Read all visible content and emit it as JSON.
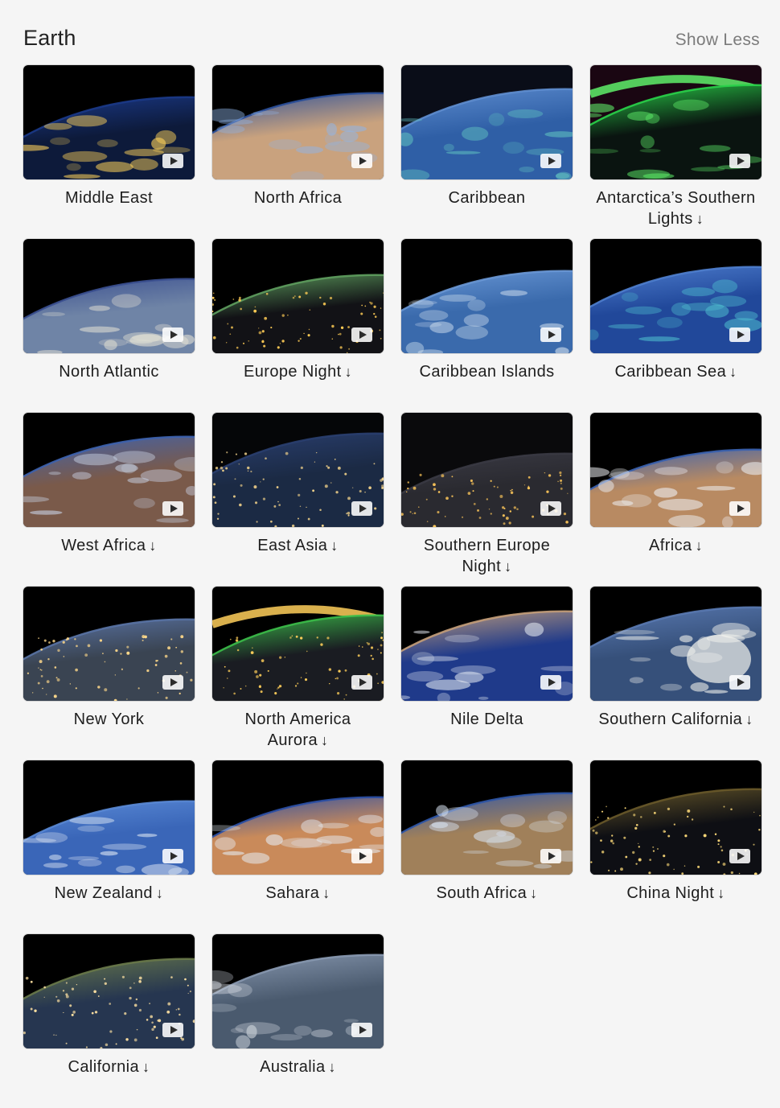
{
  "section": {
    "title": "Earth",
    "toggle_label": "Show Less"
  },
  "download_glyph": "↓",
  "tiles": [
    {
      "name": "Middle East",
      "downloadable": false,
      "scene": "dayrim",
      "colors": {
        "sky": "#000000",
        "ground": "#0d1a3a",
        "rim": "#1b3a8a",
        "glow": "#ffd35a"
      }
    },
    {
      "name": "North Africa",
      "downloadable": false,
      "scene": "desert",
      "colors": {
        "sky": "#000000",
        "ground": "#c9a27e",
        "rim": "#2a4f9a",
        "glow": "#8fb5e8"
      }
    },
    {
      "name": "Caribbean",
      "downloadable": false,
      "scene": "ocean",
      "colors": {
        "sky": "#0a0d18",
        "ground": "#2f5fa6",
        "rim": "#5f8ed0",
        "glow": "#5fc0c0"
      }
    },
    {
      "name": "Antarctica’s Southern Lights",
      "downloadable": true,
      "scene": "aurora",
      "colors": {
        "sky": "#1a0612",
        "ground": "#0a1410",
        "rim": "#2ad44a",
        "glow": "#5ff06a"
      }
    },
    {
      "name": "North Atlantic",
      "downloadable": false,
      "scene": "clouds",
      "colors": {
        "sky": "#000000",
        "ground": "#6f84a6",
        "rim": "#3a4f90",
        "glow": "#e8e4d6"
      }
    },
    {
      "name": "Europe Night",
      "downloadable": true,
      "scene": "night",
      "colors": {
        "sky": "#000000",
        "ground": "#121216",
        "rim": "#5fa05f",
        "glow": "#ffcc55"
      }
    },
    {
      "name": "Caribbean Islands",
      "downloadable": false,
      "scene": "ocean",
      "colors": {
        "sky": "#000000",
        "ground": "#3a6aac",
        "rim": "#6a98d6",
        "glow": "#d9e6f2"
      }
    },
    {
      "name": "Caribbean Sea",
      "downloadable": true,
      "scene": "ocean",
      "colors": {
        "sky": "#000000",
        "ground": "#21489a",
        "rim": "#4f7fcf",
        "glow": "#4fbfcf"
      }
    },
    {
      "name": "West Africa",
      "downloadable": true,
      "scene": "desert",
      "colors": {
        "sky": "#000000",
        "ground": "#7a5a4a",
        "rim": "#3d63b0",
        "glow": "#c9d3e6"
      }
    },
    {
      "name": "East Asia",
      "downloadable": true,
      "scene": "night",
      "colors": {
        "sky": "#050608",
        "ground": "#1b2a44",
        "rim": "#2a3f70",
        "glow": "#f2d28a"
      }
    },
    {
      "name": "Southern Europe Night",
      "downloadable": true,
      "scene": "night",
      "colors": {
        "sky": "#0a0a0c",
        "ground": "#2a2a30",
        "rim": "#3a3a44",
        "glow": "#ffc85a"
      }
    },
    {
      "name": "Africa",
      "downloadable": true,
      "scene": "clouds",
      "colors": {
        "sky": "#000000",
        "ground": "#b88a62",
        "rim": "#3a62b0",
        "glow": "#eef0f4"
      }
    },
    {
      "name": "New York",
      "downloadable": false,
      "scene": "night",
      "colors": {
        "sky": "#000000",
        "ground": "#3a4452",
        "rim": "#5a74a6",
        "glow": "#ffd98a"
      }
    },
    {
      "name": "North America Aurora",
      "downloadable": true,
      "scene": "auroranight",
      "colors": {
        "sky": "#000000",
        "ground": "#1a1c22",
        "rim": "#3cc04a",
        "glow": "#ffcf5a"
      }
    },
    {
      "name": "Nile Delta",
      "downloadable": false,
      "scene": "desert",
      "colors": {
        "sky": "#000000",
        "ground": "#1f3a8a",
        "rim": "#c6a07a",
        "glow": "#e6ebf2"
      }
    },
    {
      "name": "Southern California",
      "downloadable": true,
      "scene": "glare",
      "colors": {
        "sky": "#000000",
        "ground": "#36507a",
        "rim": "#5a7ab2",
        "glow": "#f4f4ee"
      }
    },
    {
      "name": "New Zealand",
      "downloadable": true,
      "scene": "clouds",
      "colors": {
        "sky": "#000000",
        "ground": "#3a66b8",
        "rim": "#5a8ad6",
        "glow": "#e6edf6"
      }
    },
    {
      "name": "Sahara",
      "downloadable": true,
      "scene": "desert",
      "colors": {
        "sky": "#000000",
        "ground": "#c98a5a",
        "rim": "#2a4fa6",
        "glow": "#e6eef6"
      }
    },
    {
      "name": "South Africa",
      "downloadable": true,
      "scene": "desert",
      "colors": {
        "sky": "#000000",
        "ground": "#a0805a",
        "rim": "#2f56a8",
        "glow": "#d6e0ee"
      }
    },
    {
      "name": "China Night",
      "downloadable": true,
      "scene": "night",
      "colors": {
        "sky": "#000000",
        "ground": "#0e0f14",
        "rim": "#6a5a2a",
        "glow": "#ffdc7a"
      }
    },
    {
      "name": "California",
      "downloadable": true,
      "scene": "night",
      "colors": {
        "sky": "#000000",
        "ground": "#263650",
        "rim": "#6a7a4a",
        "glow": "#ffe2a2"
      }
    },
    {
      "name": "Australia",
      "downloadable": true,
      "scene": "dayrim",
      "colors": {
        "sky": "#000000",
        "ground": "#4a5a6e",
        "rim": "#8a9ab2",
        "glow": "#d0d6de"
      }
    }
  ]
}
